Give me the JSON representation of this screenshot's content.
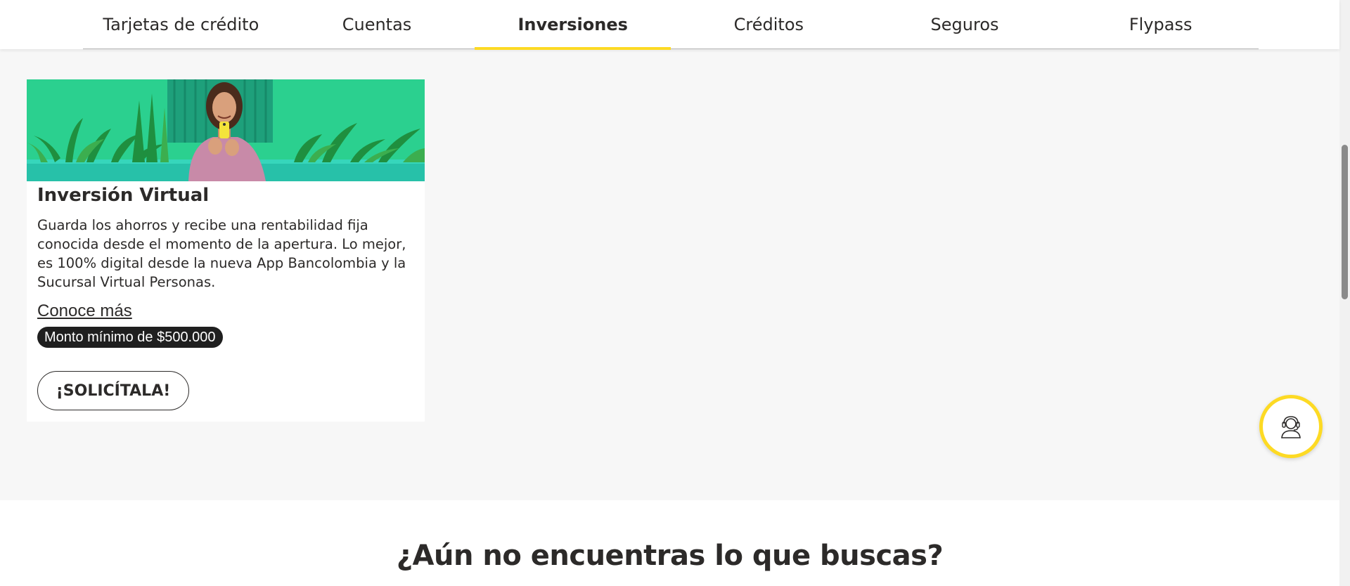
{
  "tabs": [
    {
      "label": "Tarjetas de crédito",
      "active": false
    },
    {
      "label": "Cuentas",
      "active": false
    },
    {
      "label": "Inversiones",
      "active": true
    },
    {
      "label": "Créditos",
      "active": false
    },
    {
      "label": "Seguros",
      "active": false
    },
    {
      "label": "Flypass",
      "active": false
    }
  ],
  "card": {
    "image_icon": "woman-with-phone-photo",
    "title": "Inversión Virtual",
    "description": "Guarda los ahorros y recibe una rentabilidad fija conocida desde el momento de la apertura. Lo mejor, es 100% digital desde la nueva App Bancolombia y la Sucursal Virtual Personas.",
    "link_label": "Conoce más",
    "badge": "Monto mínimo de $500.000",
    "cta_label": "¡SOLICÍTALA!"
  },
  "help_button": {
    "icon": "support-agent-icon"
  },
  "bottom": {
    "title": "¿Aún no encuentras lo que buscas?"
  },
  "colors": {
    "accent_yellow": "#fdda24",
    "text_dark": "#2c2a29",
    "image_green": "#2fd38f",
    "badge_bg": "#1f1f1f",
    "page_bg": "#f7f7f7"
  }
}
